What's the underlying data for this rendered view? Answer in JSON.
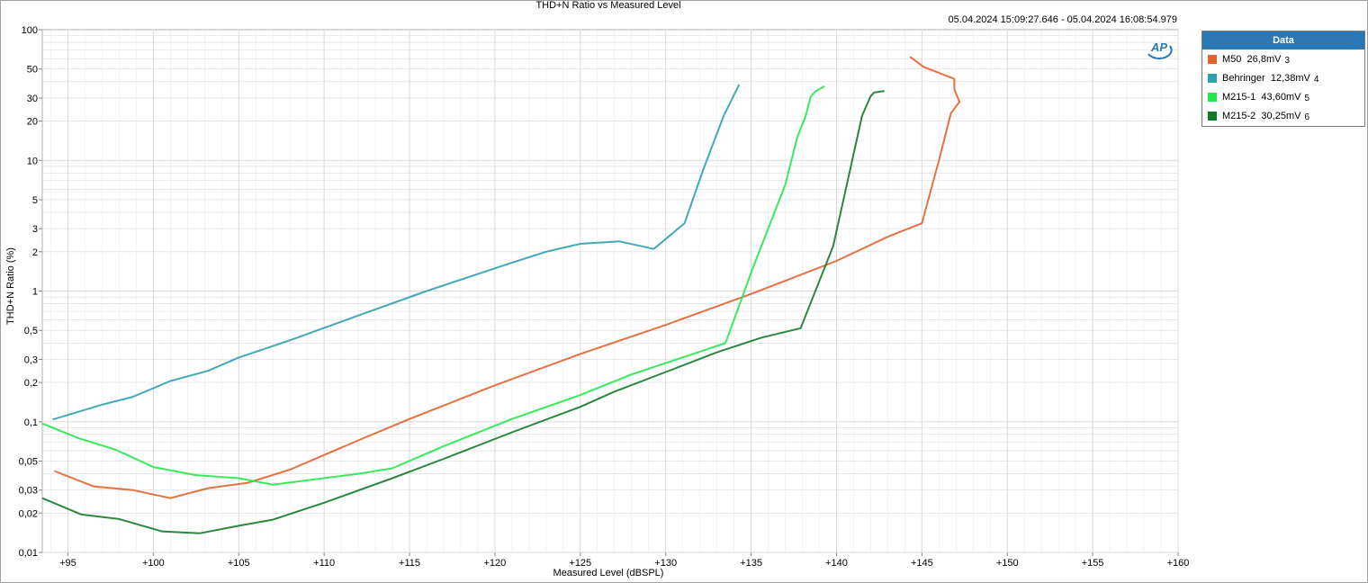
{
  "colors": {
    "background": "#ffffff",
    "grid": "#d9d9d9",
    "legend_header": "#2a77b5"
  },
  "icons": {
    "logo": "ap-logo"
  },
  "header": {
    "title": "THD+N Ratio vs Measured Level",
    "timestamp": "05.04.2024 15:09:27.646 - 05.04.2024 16:08:54.979"
  },
  "legend": {
    "title": "Data",
    "items": [
      {
        "name": "M50",
        "value": "26,8mV",
        "index": "3",
        "color": "#e2622b"
      },
      {
        "name": "Behringer",
        "value": "12,38mV",
        "index": "4",
        "color": "#2ea0b0"
      },
      {
        "name": "M215-1",
        "value": "43,60mV",
        "index": "5",
        "color": "#22e84a"
      },
      {
        "name": "M215-2",
        "value": "30,25mV",
        "index": "6",
        "color": "#137a2a"
      }
    ]
  },
  "chart_data": {
    "type": "line",
    "title": "THD+N Ratio vs Measured Level",
    "xlabel": "Measured Level (dBSPL)",
    "ylabel": "THD+N Ratio (%)",
    "xlim": [
      93.5,
      160
    ],
    "ylim": [
      0.01,
      100
    ],
    "yscale": "log",
    "grid": true,
    "legend_position": "right",
    "x_ticks": [
      "+95",
      "+100",
      "+105",
      "+110",
      "+115",
      "+120",
      "+125",
      "+130",
      "+135",
      "+140",
      "+145",
      "+150",
      "+155",
      "+160"
    ],
    "y_ticks": [
      "100",
      "50",
      "30",
      "20",
      "10",
      "5",
      "3",
      "2",
      "1",
      "0,5",
      "0,3",
      "0,2",
      "0,1",
      "0,05",
      "0,03",
      "0,02",
      "0,01"
    ],
    "series": [
      {
        "name": "M50  26,8mV",
        "color": "#e2622b",
        "x": [
          94.2,
          96.5,
          98.8,
          101,
          103.2,
          105.5,
          108,
          112,
          115,
          120,
          125,
          130,
          135,
          140,
          143,
          145,
          146,
          146.7,
          147.2,
          146.9,
          146.9,
          145.1,
          144.3
        ],
        "y": [
          0.042,
          0.032,
          0.03,
          0.026,
          0.031,
          0.034,
          0.043,
          0.072,
          0.105,
          0.19,
          0.33,
          0.55,
          0.95,
          1.7,
          2.6,
          3.3,
          10,
          23,
          28,
          35,
          42,
          52,
          62
        ]
      },
      {
        "name": "Behringer  12,38mV",
        "color": "#2ea0b0",
        "x": [
          94.1,
          97,
          98.8,
          101,
          103.2,
          105,
          108,
          112,
          116,
          121,
          123,
          125,
          127.3,
          129.3,
          131.1,
          132.2,
          133.4,
          134.3
        ],
        "y": [
          0.104,
          0.135,
          0.155,
          0.205,
          0.245,
          0.31,
          0.42,
          0.65,
          1.0,
          1.65,
          2.0,
          2.3,
          2.4,
          2.1,
          3.3,
          8.5,
          22,
          38
        ]
      },
      {
        "name": "M215-1  43,60mV",
        "color": "#22e84a",
        "x": [
          93.5,
          95.6,
          97.8,
          100,
          102.5,
          105,
          107,
          112,
          114,
          117,
          121,
          125,
          128,
          131.3,
          133.5,
          135.1,
          137,
          137.7,
          138.2,
          138.5,
          138.8,
          139.3
        ],
        "y": [
          0.097,
          0.075,
          0.061,
          0.045,
          0.039,
          0.037,
          0.033,
          0.04,
          0.044,
          0.065,
          0.105,
          0.16,
          0.23,
          0.32,
          0.4,
          1.5,
          6.5,
          15,
          22,
          31,
          34,
          37
        ]
      },
      {
        "name": "M215-2  30,25mV",
        "color": "#137a2a",
        "x": [
          93.5,
          95.8,
          98,
          100.5,
          102.7,
          105,
          107,
          110,
          114,
          117,
          121,
          125,
          127,
          130,
          133,
          135.6,
          137.9,
          139.8,
          141.5,
          142,
          142.2,
          142.8
        ],
        "y": [
          0.026,
          0.0195,
          0.018,
          0.0145,
          0.014,
          0.016,
          0.0178,
          0.024,
          0.037,
          0.052,
          0.083,
          0.13,
          0.17,
          0.24,
          0.34,
          0.44,
          0.52,
          2.2,
          22,
          31,
          33,
          34
        ]
      }
    ]
  }
}
